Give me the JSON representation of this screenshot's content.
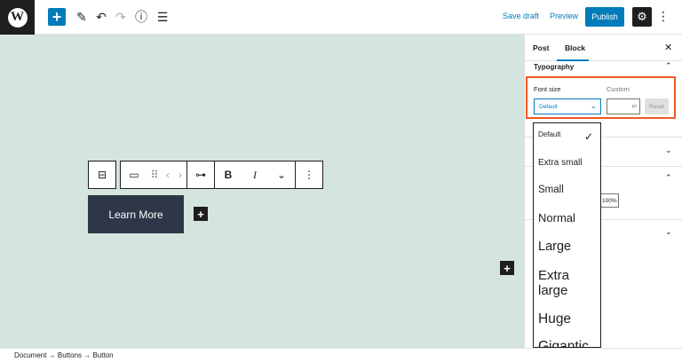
{
  "header": {
    "logo_glyph": "W",
    "add_icon": "+",
    "tools_icon": "✎",
    "undo_icon": "↶",
    "redo_icon": "↷",
    "info_icon": "ⓘ",
    "list_view_icon": "☰",
    "save_draft_label": "Save draft",
    "preview_label": "Preview",
    "publish_label": "Publish",
    "settings_icon": "⚙",
    "more_icon": "⋮"
  },
  "block_toolbar": {
    "parent_icon": "⊟",
    "button_icon": "▭",
    "drag_icon": "⠿",
    "move_left_icon": "‹",
    "move_right_icon": "›",
    "link_icon": "⊶",
    "bold_label": "B",
    "italic_label": "I",
    "more_rich_icon": "⌄",
    "options_icon": "⋮"
  },
  "canvas": {
    "button_text": "Learn More",
    "appender_glyph": "+"
  },
  "sidebar": {
    "tabs": [
      {
        "label": "Post"
      },
      {
        "label": "Block"
      }
    ],
    "close_icon": "✕",
    "typography_title": "Typography",
    "font_size_label": "Font size",
    "custom_label": "Custom",
    "font_size_selected": "Default",
    "custom_unit": "px",
    "reset_label": "Reset",
    "width_value": "100%",
    "chevron_up": "⌃",
    "chevron_down": "⌄"
  },
  "font_size_options": [
    {
      "label": "Default"
    },
    {
      "label": "Extra small"
    },
    {
      "label": "Small"
    },
    {
      "label": "Normal"
    },
    {
      "label": "Large"
    },
    {
      "label": "Extra large"
    },
    {
      "label": "Huge"
    },
    {
      "label": "Gigantic"
    }
  ],
  "selected_check": "✓",
  "breadcrumb": {
    "items": [
      "Document",
      "Buttons",
      "Button"
    ],
    "separator": "→",
    "text": "Document → Buttons → Button"
  },
  "colors": {
    "accent": "#007cba",
    "canvas_bg": "#d4e4de",
    "button_bg": "#2d3748",
    "highlight": "#f05a24"
  }
}
